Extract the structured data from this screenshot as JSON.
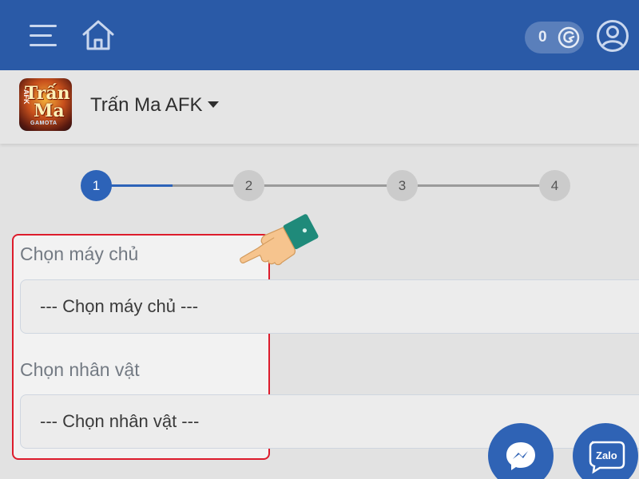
{
  "header": {
    "coin_count": "0",
    "icons": {
      "menu": "hamburger-menu-icon",
      "home": "home-icon",
      "coin": "coin-icon",
      "user": "user-account-icon"
    },
    "background_color": "#2a5aa7"
  },
  "game": {
    "logo_line1": "Trấn",
    "logo_line2": "Ma",
    "logo_side": "AFK",
    "logo_brand": "GAMOTA",
    "name": "Trấn Ma AFK"
  },
  "stepper": {
    "steps": [
      "1",
      "2",
      "3",
      "4"
    ],
    "current_step": 1,
    "active_color": "#2d63b8"
  },
  "form": {
    "server": {
      "label": "Chọn máy chủ",
      "placeholder": "--- Chọn máy chủ ---"
    },
    "character": {
      "label": "Chọn nhân vật",
      "placeholder": "--- Chọn nhân vật ---"
    },
    "highlight_color": "#dd1c2c"
  },
  "floating_buttons": {
    "messenger_icon": "messenger-icon",
    "zalo_label": "Zalo"
  },
  "annotation": {
    "pointer": "pointing-hand-icon"
  }
}
